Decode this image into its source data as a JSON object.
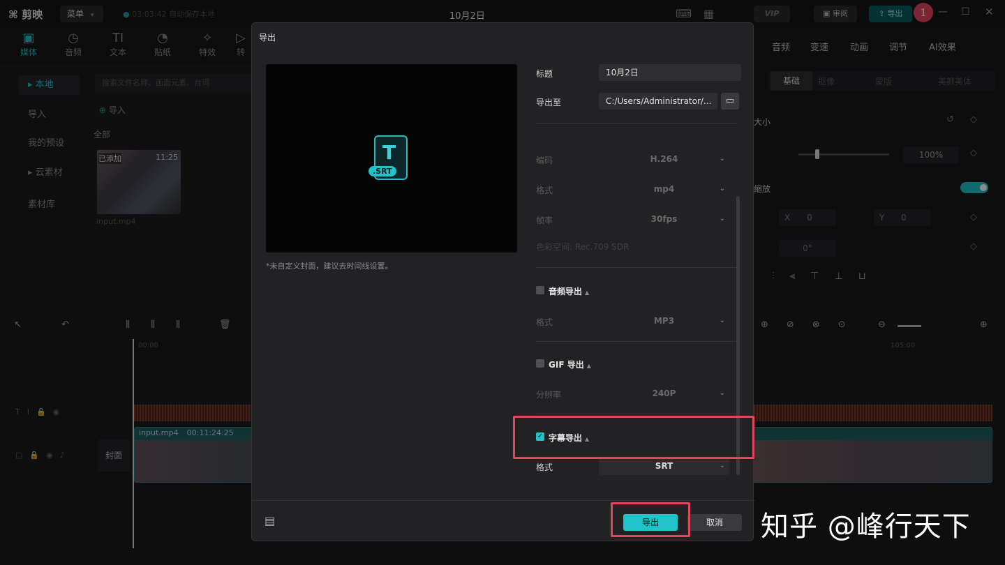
{
  "topbar": {
    "app_name": "剪映",
    "menu_label": "菜单",
    "autosave": "03:03:42 自动保存本地",
    "project_title": "10月2日",
    "vip": "VIP",
    "review": "审阅",
    "export": "导出",
    "badge": "1"
  },
  "tools": [
    {
      "label": "媒体",
      "icon": "media-icon"
    },
    {
      "label": "音频",
      "icon": "audio-icon"
    },
    {
      "label": "文本",
      "icon": "text-icon"
    },
    {
      "label": "贴纸",
      "icon": "sticker-icon"
    },
    {
      "label": "特效",
      "icon": "effects-icon"
    },
    {
      "label": "转",
      "icon": "transition-icon"
    }
  ],
  "left_nav": [
    "本地",
    "导入",
    "我的预设",
    "云素材",
    "素材库"
  ],
  "media": {
    "search_placeholder": "搜索文件名称、画面元素、台词",
    "import": "导入",
    "all": "全部",
    "thumb_added": "已添加",
    "thumb_time": "11:25",
    "thumb_name": "input.mp4"
  },
  "right_tabs": [
    "音频",
    "变速",
    "动画",
    "调节",
    "AI效果"
  ],
  "right_subtabs": [
    "基础",
    "抠像",
    "蒙版",
    "美颜美体"
  ],
  "right": {
    "size_label": "大小",
    "scale": "100%",
    "scale_label": "缩放",
    "x_label": "X",
    "x_val": "0",
    "y_label": "Y",
    "y_val": "0",
    "rotate": "0°"
  },
  "timeline": {
    "clip_name": "input.mp4",
    "clip_time": "00:11:24:25",
    "cover": "封面",
    "time_start": "00:00",
    "time_end": "105:00"
  },
  "dialog": {
    "title": "导出",
    "cover_note": "*未自定义封面，建议去时间线设置。",
    "srt_tag": ".SRT",
    "srt_glyph": "T",
    "title_label": "标题",
    "title_value": "10月2日",
    "export_to_label": "导出至",
    "export_path": "C:/Users/Administrator/...",
    "codec_label": "编码",
    "codec_value": "H.264",
    "format_label": "格式",
    "format_value": "mp4",
    "fps_label": "帧率",
    "fps_value": "30fps",
    "color_space": "色彩空间: Rec.709 SDR",
    "audio_section": "音频导出",
    "audio_format_label": "格式",
    "audio_format_value": "MP3",
    "gif_section": "GIF 导出",
    "gif_res_label": "分辨率",
    "gif_res_value": "240P",
    "subtitle_section": "字幕导出",
    "subtitle_format_label": "格式",
    "subtitle_format_value": "SRT",
    "export_button": "导出",
    "cancel_button": "取消"
  },
  "watermark": "知乎 @峰行天下",
  "colors": {
    "accent": "#1fc3c9",
    "highlight": "#e2455e"
  }
}
